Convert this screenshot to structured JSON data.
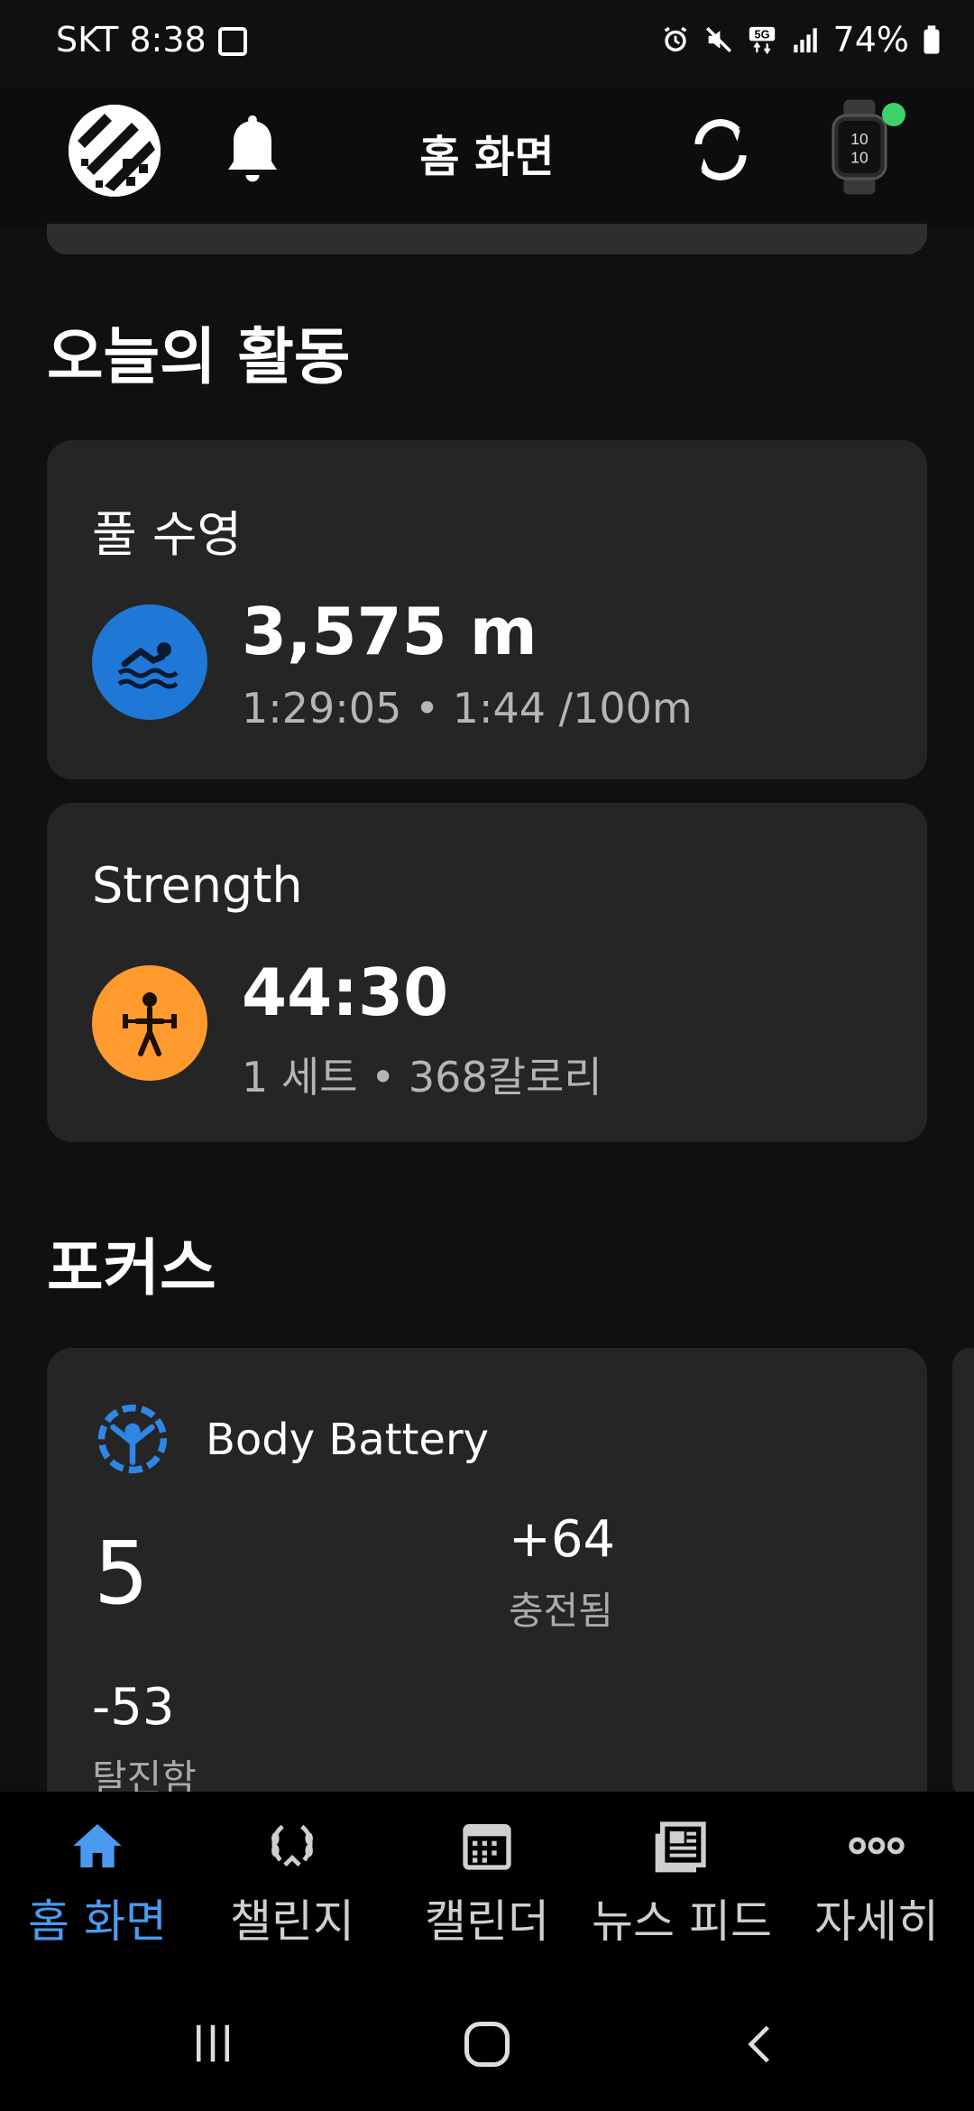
{
  "status_bar": {
    "carrier_time": "SKT 8:38",
    "battery": "74%"
  },
  "header": {
    "title": "홈 화면"
  },
  "activities": {
    "heading": "오늘의 활동",
    "items": [
      {
        "title": "풀 수영",
        "value": "3,575 m",
        "detail": "1:29:05 • 1:44 /100m",
        "icon": "swimming-icon",
        "color": "#1f78d6"
      },
      {
        "title": "Strength",
        "value": "44:30",
        "detail": "1 세트 • 368칼로리",
        "icon": "weightlifting-icon",
        "color": "#ff9a2e"
      }
    ]
  },
  "focus": {
    "heading": "포커스",
    "body_battery": {
      "title": "Body Battery",
      "current": "5",
      "charged_value": "+64",
      "charged_label": "충전됨",
      "drained_value": "-53",
      "drained_label": "탈진함",
      "accent": "#2f86e6"
    }
  },
  "bottom_nav": {
    "items": [
      {
        "label": "홈 화면",
        "icon": "home-icon",
        "active": true
      },
      {
        "label": "챌린지",
        "icon": "laurel-icon",
        "active": false
      },
      {
        "label": "캘린더",
        "icon": "calendar-icon",
        "active": false
      },
      {
        "label": "뉴스 피드",
        "icon": "newsfeed-icon",
        "active": false
      },
      {
        "label": "자세히",
        "icon": "more-icon",
        "active": false
      }
    ],
    "active_color": "#4a9bf0"
  }
}
